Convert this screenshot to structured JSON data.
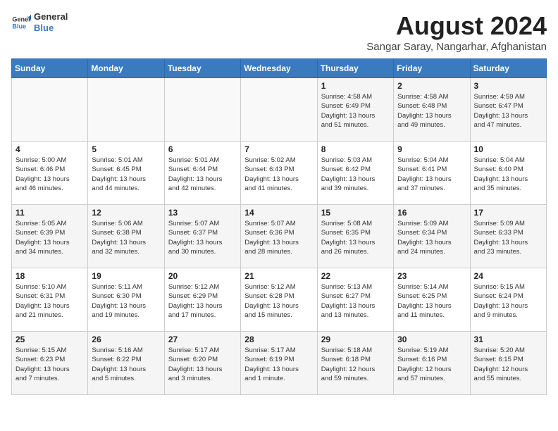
{
  "header": {
    "logo_general": "General",
    "logo_blue": "Blue",
    "month_year": "August 2024",
    "location": "Sangar Saray, Nangarhar, Afghanistan"
  },
  "weekdays": [
    "Sunday",
    "Monday",
    "Tuesday",
    "Wednesday",
    "Thursday",
    "Friday",
    "Saturday"
  ],
  "weeks": [
    [
      {
        "day": "",
        "info": ""
      },
      {
        "day": "",
        "info": ""
      },
      {
        "day": "",
        "info": ""
      },
      {
        "day": "",
        "info": ""
      },
      {
        "day": "1",
        "info": "Sunrise: 4:58 AM\nSunset: 6:49 PM\nDaylight: 13 hours\nand 51 minutes."
      },
      {
        "day": "2",
        "info": "Sunrise: 4:58 AM\nSunset: 6:48 PM\nDaylight: 13 hours\nand 49 minutes."
      },
      {
        "day": "3",
        "info": "Sunrise: 4:59 AM\nSunset: 6:47 PM\nDaylight: 13 hours\nand 47 minutes."
      }
    ],
    [
      {
        "day": "4",
        "info": "Sunrise: 5:00 AM\nSunset: 6:46 PM\nDaylight: 13 hours\nand 46 minutes."
      },
      {
        "day": "5",
        "info": "Sunrise: 5:01 AM\nSunset: 6:45 PM\nDaylight: 13 hours\nand 44 minutes."
      },
      {
        "day": "6",
        "info": "Sunrise: 5:01 AM\nSunset: 6:44 PM\nDaylight: 13 hours\nand 42 minutes."
      },
      {
        "day": "7",
        "info": "Sunrise: 5:02 AM\nSunset: 6:43 PM\nDaylight: 13 hours\nand 41 minutes."
      },
      {
        "day": "8",
        "info": "Sunrise: 5:03 AM\nSunset: 6:42 PM\nDaylight: 13 hours\nand 39 minutes."
      },
      {
        "day": "9",
        "info": "Sunrise: 5:04 AM\nSunset: 6:41 PM\nDaylight: 13 hours\nand 37 minutes."
      },
      {
        "day": "10",
        "info": "Sunrise: 5:04 AM\nSunset: 6:40 PM\nDaylight: 13 hours\nand 35 minutes."
      }
    ],
    [
      {
        "day": "11",
        "info": "Sunrise: 5:05 AM\nSunset: 6:39 PM\nDaylight: 13 hours\nand 34 minutes."
      },
      {
        "day": "12",
        "info": "Sunrise: 5:06 AM\nSunset: 6:38 PM\nDaylight: 13 hours\nand 32 minutes."
      },
      {
        "day": "13",
        "info": "Sunrise: 5:07 AM\nSunset: 6:37 PM\nDaylight: 13 hours\nand 30 minutes."
      },
      {
        "day": "14",
        "info": "Sunrise: 5:07 AM\nSunset: 6:36 PM\nDaylight: 13 hours\nand 28 minutes."
      },
      {
        "day": "15",
        "info": "Sunrise: 5:08 AM\nSunset: 6:35 PM\nDaylight: 13 hours\nand 26 minutes."
      },
      {
        "day": "16",
        "info": "Sunrise: 5:09 AM\nSunset: 6:34 PM\nDaylight: 13 hours\nand 24 minutes."
      },
      {
        "day": "17",
        "info": "Sunrise: 5:09 AM\nSunset: 6:33 PM\nDaylight: 13 hours\nand 23 minutes."
      }
    ],
    [
      {
        "day": "18",
        "info": "Sunrise: 5:10 AM\nSunset: 6:31 PM\nDaylight: 13 hours\nand 21 minutes."
      },
      {
        "day": "19",
        "info": "Sunrise: 5:11 AM\nSunset: 6:30 PM\nDaylight: 13 hours\nand 19 minutes."
      },
      {
        "day": "20",
        "info": "Sunrise: 5:12 AM\nSunset: 6:29 PM\nDaylight: 13 hours\nand 17 minutes."
      },
      {
        "day": "21",
        "info": "Sunrise: 5:12 AM\nSunset: 6:28 PM\nDaylight: 13 hours\nand 15 minutes."
      },
      {
        "day": "22",
        "info": "Sunrise: 5:13 AM\nSunset: 6:27 PM\nDaylight: 13 hours\nand 13 minutes."
      },
      {
        "day": "23",
        "info": "Sunrise: 5:14 AM\nSunset: 6:25 PM\nDaylight: 13 hours\nand 11 minutes."
      },
      {
        "day": "24",
        "info": "Sunrise: 5:15 AM\nSunset: 6:24 PM\nDaylight: 13 hours\nand 9 minutes."
      }
    ],
    [
      {
        "day": "25",
        "info": "Sunrise: 5:15 AM\nSunset: 6:23 PM\nDaylight: 13 hours\nand 7 minutes."
      },
      {
        "day": "26",
        "info": "Sunrise: 5:16 AM\nSunset: 6:22 PM\nDaylight: 13 hours\nand 5 minutes."
      },
      {
        "day": "27",
        "info": "Sunrise: 5:17 AM\nSunset: 6:20 PM\nDaylight: 13 hours\nand 3 minutes."
      },
      {
        "day": "28",
        "info": "Sunrise: 5:17 AM\nSunset: 6:19 PM\nDaylight: 13 hours\nand 1 minute."
      },
      {
        "day": "29",
        "info": "Sunrise: 5:18 AM\nSunset: 6:18 PM\nDaylight: 12 hours\nand 59 minutes."
      },
      {
        "day": "30",
        "info": "Sunrise: 5:19 AM\nSunset: 6:16 PM\nDaylight: 12 hours\nand 57 minutes."
      },
      {
        "day": "31",
        "info": "Sunrise: 5:20 AM\nSunset: 6:15 PM\nDaylight: 12 hours\nand 55 minutes."
      }
    ]
  ]
}
